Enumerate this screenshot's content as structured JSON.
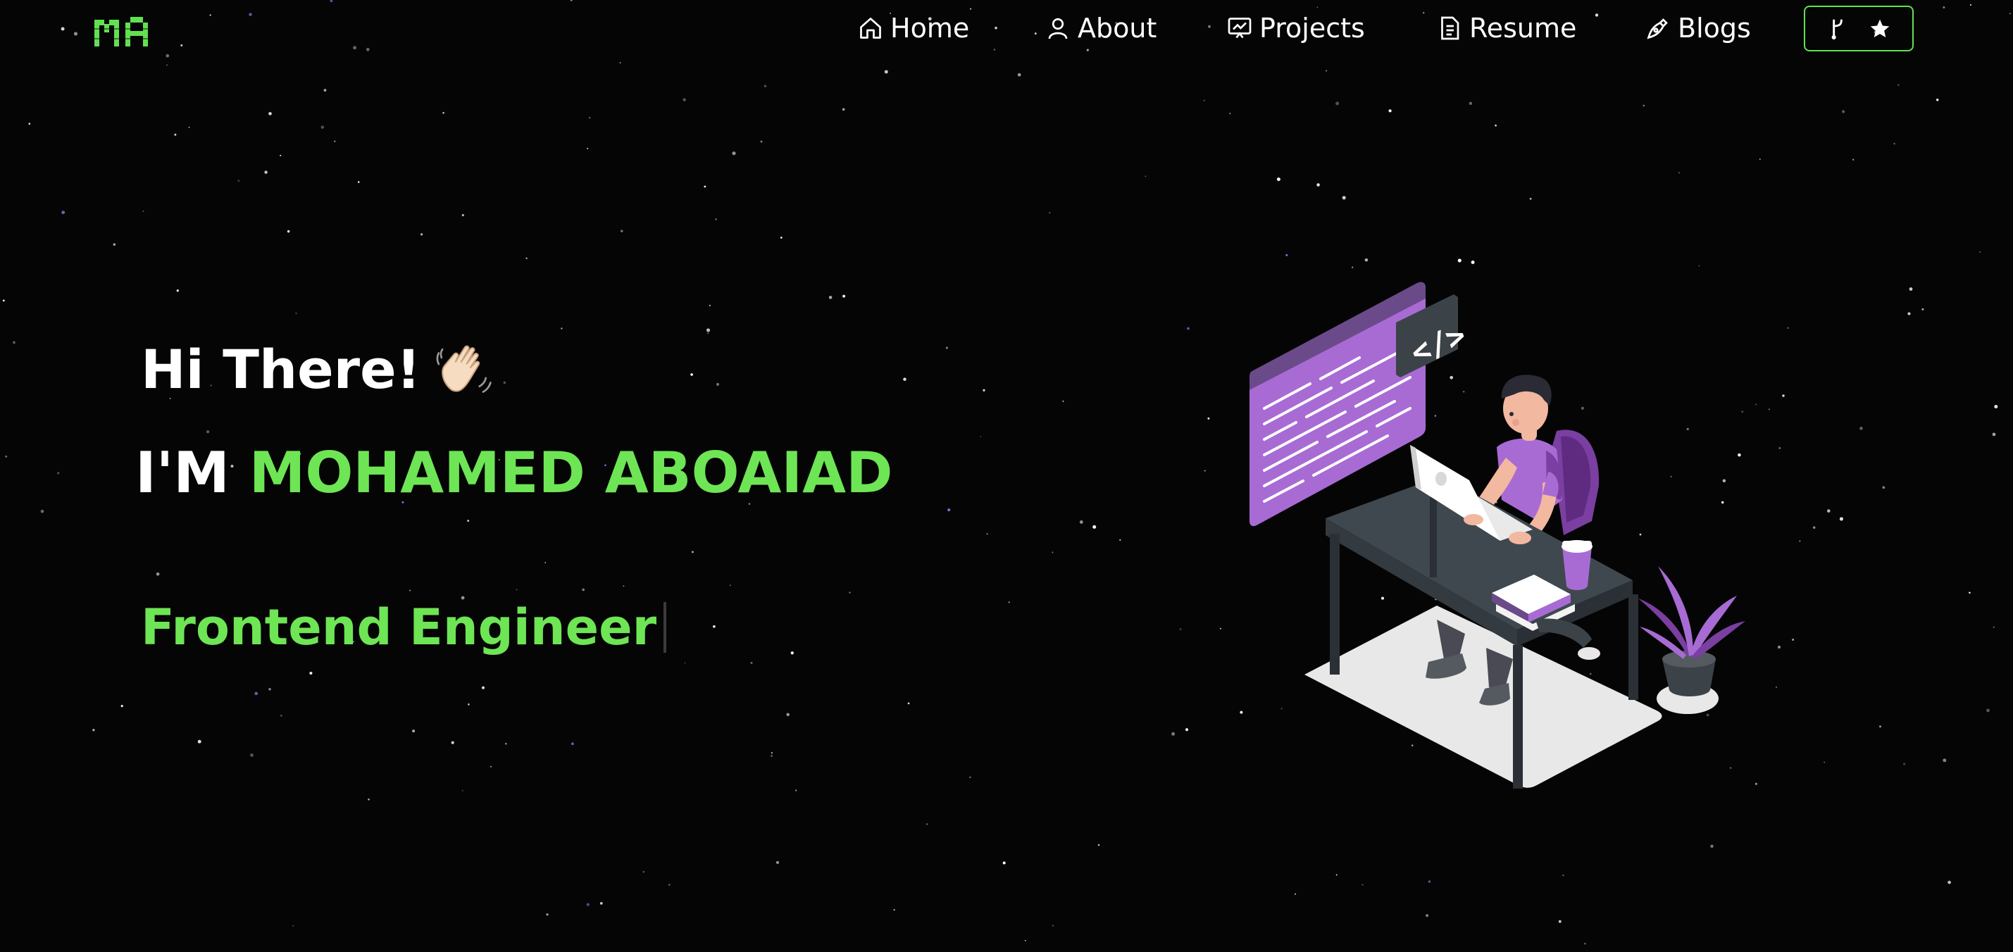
{
  "brand": {
    "logo_text": "MA",
    "accent": "#6ee554"
  },
  "nav": {
    "items": [
      {
        "label": "Home",
        "icon": "home-icon"
      },
      {
        "label": "About",
        "icon": "user-icon"
      },
      {
        "label": "Projects",
        "icon": "presentation-icon"
      },
      {
        "label": "Resume",
        "icon": "document-icon"
      },
      {
        "label": "Blogs",
        "icon": "pen-nib-icon"
      }
    ],
    "github_button": {
      "icons": [
        "git-fork-icon",
        "star-icon"
      ]
    }
  },
  "hero": {
    "greeting": "Hi There!",
    "greeting_emoji": "waving-hand-icon",
    "name_prefix": "I'M",
    "name": "MOHAMED ABOAIAD",
    "role": "Frontend Engineer"
  },
  "illustration": {
    "subject": "developer-at-desk-illustration",
    "code_tag": "</>"
  }
}
